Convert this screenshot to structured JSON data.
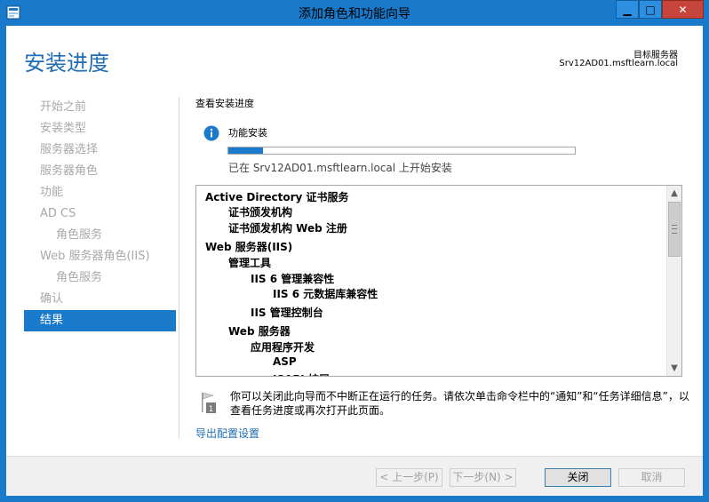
{
  "window": {
    "title": "添加角色和功能向导",
    "controls": {
      "minimize": "▁",
      "maximize": "□",
      "close": "✕"
    }
  },
  "header": {
    "page_title": "安装进度",
    "destination_label": "目标服务器",
    "destination_server": "Srv12AD01.msftlearn.local"
  },
  "nav": {
    "items": [
      {
        "label": "开始之前",
        "sub": false,
        "active": false
      },
      {
        "label": "安装类型",
        "sub": false,
        "active": false
      },
      {
        "label": "服务器选择",
        "sub": false,
        "active": false
      },
      {
        "label": "服务器角色",
        "sub": false,
        "active": false
      },
      {
        "label": "功能",
        "sub": false,
        "active": false
      },
      {
        "label": "AD CS",
        "sub": false,
        "active": false
      },
      {
        "label": "角色服务",
        "sub": true,
        "active": false
      },
      {
        "label": "Web 服务器角色(IIS)",
        "sub": false,
        "active": false
      },
      {
        "label": "角色服务",
        "sub": true,
        "active": false
      },
      {
        "label": "确认",
        "sub": false,
        "active": false
      },
      {
        "label": "结果",
        "sub": false,
        "active": true
      }
    ]
  },
  "content": {
    "section_label": "查看安装进度",
    "progress": {
      "title": "功能安装",
      "fraction": 0.1,
      "status": "已在 Srv12AD01.msftlearn.local 上开始安装"
    },
    "features": [
      {
        "label": "Active Directory 证书服务",
        "level": 0
      },
      {
        "label": "证书颁发机构",
        "level": 1
      },
      {
        "label": "证书颁发机构 Web 注册",
        "level": 1
      },
      {
        "label": "Web 服务器(IIS)",
        "level": 0
      },
      {
        "label": "管理工具",
        "level": 1
      },
      {
        "label": "IIS 6 管理兼容性",
        "level": 2
      },
      {
        "label": "IIS 6 元数据库兼容性",
        "level": 3
      },
      {
        "label": "IIS 管理控制台",
        "level": 2
      },
      {
        "label": "Web 服务器",
        "level": 1
      },
      {
        "label": "应用程序开发",
        "level": 2
      },
      {
        "label": "ASP",
        "level": 3
      },
      {
        "label": "ISAPI 扩展",
        "level": 3
      }
    ],
    "notice": "你可以关闭此向导而不中断正在运行的任务。请依次单击命令栏中的“通知”和“任务详细信息”，以查看任务进度或再次打开此页面。",
    "notice_badge": "1",
    "export_link": "导出配置设置"
  },
  "footer": {
    "prev": "< 上一步(P)",
    "next": "下一步(N) >",
    "close": "关闭",
    "cancel": "取消"
  },
  "colors": {
    "accent": "#1979ca",
    "title_blue": "#1f6eb5",
    "nav_inactive": "#a8a8a8"
  }
}
